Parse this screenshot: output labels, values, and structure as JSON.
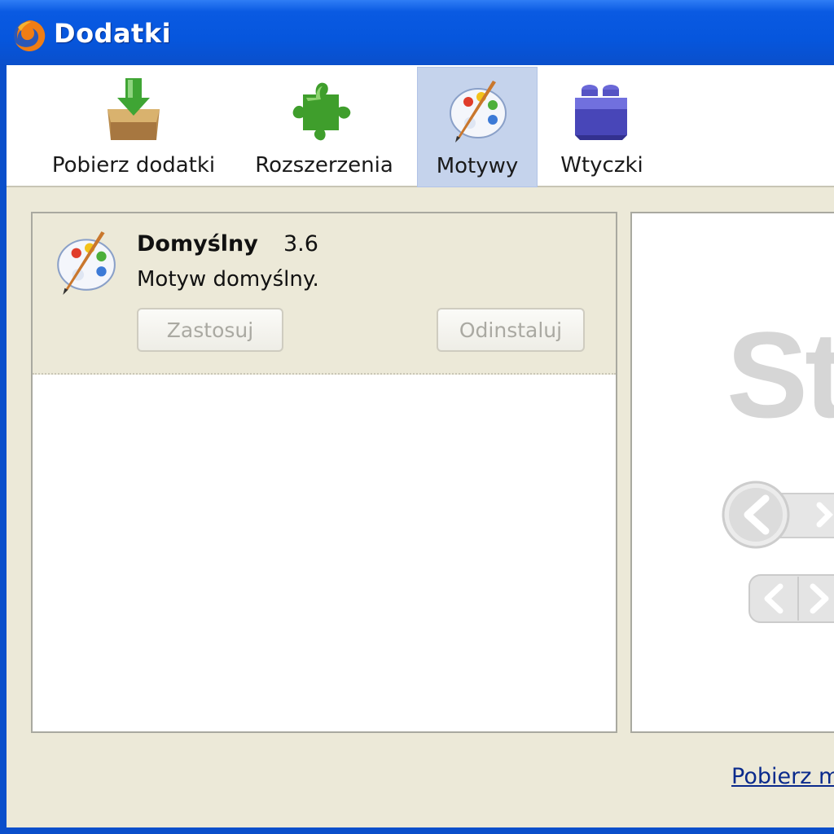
{
  "window": {
    "title": "Dodatki"
  },
  "toolbar": {
    "tabs": [
      {
        "label": "Pobierz dodatki",
        "icon": "download-box-icon",
        "selected": false
      },
      {
        "label": "Rozszerzenia",
        "icon": "puzzle-piece-icon",
        "selected": false
      },
      {
        "label": "Motywy",
        "icon": "palette-icon",
        "selected": true
      },
      {
        "label": "Wtyczki",
        "icon": "plugin-brick-icon",
        "selected": false
      }
    ]
  },
  "themes": [
    {
      "name": "Domyślny",
      "version": "3.6",
      "description": "Motyw domyślny.",
      "apply_label": "Zastosuj",
      "uninstall_label": "Odinstaluj"
    }
  ],
  "preview": {
    "text": "St"
  },
  "footer": {
    "get_more_label": "Pobierz m"
  },
  "colors": {
    "titlebar": "#0656dd",
    "selected_tab": "#c5d3ec",
    "panel_bg": "#ece9d8",
    "link": "#0a2a8c"
  }
}
